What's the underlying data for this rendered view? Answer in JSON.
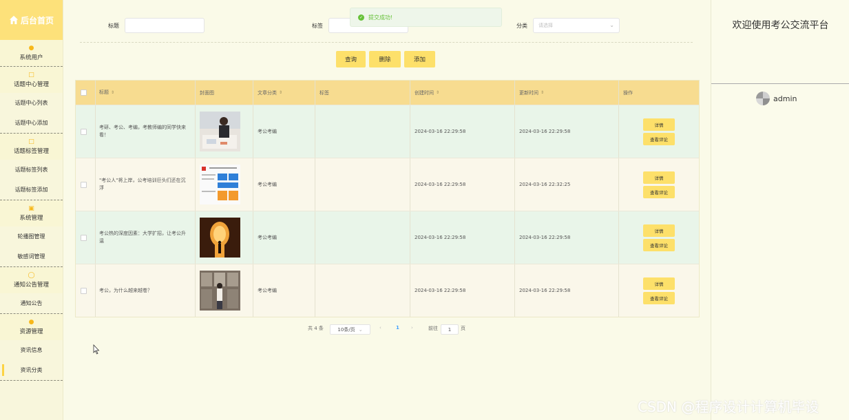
{
  "sidebar": {
    "home_label": "后台首页",
    "groups": [
      {
        "label": "系统用户",
        "icon": "user-icon",
        "items": []
      },
      {
        "label": "话题中心管理",
        "icon": "edit-icon",
        "items": [
          "话题中心列表",
          "话题中心添加"
        ]
      },
      {
        "label": "话题标签管理",
        "icon": "edit-icon",
        "items": [
          "话题标签列表",
          "话题标签添加"
        ]
      },
      {
        "label": "系统管理",
        "icon": "picture-icon",
        "items": [
          "轮播图管理",
          "敏感词管理"
        ]
      },
      {
        "label": "通知公告管理",
        "icon": "info-icon",
        "items": [
          "通知公告"
        ]
      },
      {
        "label": "资源管理",
        "icon": "location-icon",
        "items": [
          "资讯信息",
          "资讯分类"
        ]
      }
    ]
  },
  "right_panel": {
    "welcome": "欢迎使用考公交流平台",
    "username": "admin"
  },
  "toast": {
    "text": "提交成功!",
    "color": "#67c23a"
  },
  "search": {
    "title_label": "标题",
    "tag_label": "标签",
    "category_label": "分类",
    "category_placeholder": "请选择"
  },
  "actions": {
    "query": "查询",
    "delete": "删除",
    "add": "添加"
  },
  "table": {
    "headers": [
      "标题",
      "封面图",
      "文章分类",
      "标签",
      "创建时间",
      "更新时间",
      "操作"
    ],
    "rows": [
      {
        "title": "考研、考公、考编，考教师编的同学快来看！",
        "category": "考公考编",
        "tag": "",
        "created": "2024-03-16 22:29:58",
        "updated": "2024-03-16 22:29:58"
      },
      {
        "title": "\"考公人\"将上岸，公考培训巨头们还在沉浮",
        "category": "考公考编",
        "tag": "",
        "created": "2024-03-16 22:29:58",
        "updated": "2024-03-16 22:32:25"
      },
      {
        "title": "考公热的深度因素：大学扩招，让考公升温",
        "category": "考公考编",
        "tag": "",
        "created": "2024-03-16 22:29:58",
        "updated": "2024-03-16 22:29:58"
      },
      {
        "title": "考公，为什么越来越卷？",
        "category": "考公考编",
        "tag": "",
        "created": "2024-03-16 22:29:58",
        "updated": "2024-03-16 22:29:58"
      }
    ],
    "detail_label": "详情",
    "comment_label": "查看评论"
  },
  "pagination": {
    "total": "共 4 条",
    "page_size": "10条/页",
    "current_page": "1",
    "goto_prefix": "前往",
    "goto_value": "1",
    "goto_suffix": "页"
  },
  "watermark": "CSDN @程序设计计算机毕设",
  "colors": {
    "accent": "#fde06a",
    "header": "#f7dc90",
    "row_alt": "#e9f5e9"
  }
}
